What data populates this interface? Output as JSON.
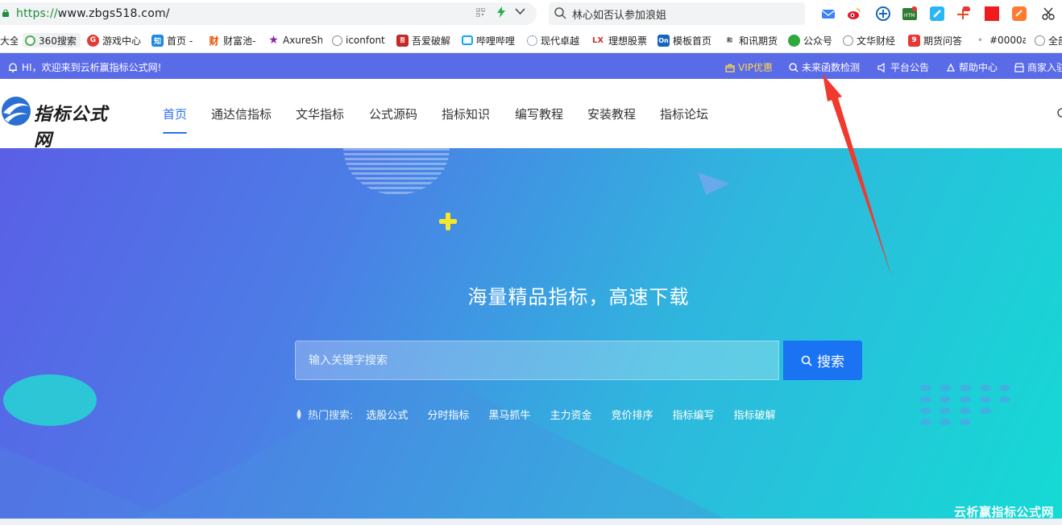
{
  "browser": {
    "url": "https://www.zbgs518.com/",
    "url_protocol": "https://",
    "url_host": "www.zbgs518.com/",
    "search_text": "林心如否认参加浪姐"
  },
  "bookmarks": [
    {
      "label": "大全",
      "color": "#555555",
      "icon": ""
    },
    {
      "label": "360搜索",
      "color": "#4caf50",
      "icon": "360-icon"
    },
    {
      "label": "游戏中心",
      "color": "#e53935",
      "icon": "game-icon"
    },
    {
      "label": "首页 -",
      "color": "#1e88e5",
      "icon": "zhi-icon",
      "glyph": "知"
    },
    {
      "label": "财富池-",
      "color": "#e65100",
      "icon": "cai-icon",
      "glyph": "财"
    },
    {
      "label": "AxureSh",
      "color": "#8e24aa",
      "icon": "star-icon"
    },
    {
      "label": "iconfont",
      "color": "#888888",
      "icon": "globe-icon"
    },
    {
      "label": "吾爱破解",
      "color": "#c62828",
      "icon": "52pj-icon"
    },
    {
      "label": "哔哩哔哩",
      "color": "#03a9f4",
      "icon": "bilibili-icon"
    },
    {
      "label": "现代卓越",
      "color": "#3949ab",
      "icon": "xd-icon"
    },
    {
      "label": "理想股票",
      "color": "#d32f2f",
      "icon": "lx-icon",
      "glyph": "LX"
    },
    {
      "label": "模板首页",
      "color": "#1565c0",
      "icon": "on-icon",
      "glyph": "On"
    },
    {
      "label": "和讯期货",
      "color": "#333333",
      "icon": "hexun-icon"
    },
    {
      "label": "公众号",
      "color": "#2eaa3a",
      "icon": "wechat-icon"
    },
    {
      "label": "文华财经",
      "color": "#888888",
      "icon": "globe-icon"
    },
    {
      "label": "期货问答",
      "color": "#e53935",
      "icon": "nine-icon",
      "glyph": "9"
    },
    {
      "label": "#0000a",
      "color": "#aaaaaa",
      "icon": "dot-icon"
    },
    {
      "label": "全部",
      "color": "#888888",
      "icon": "globe-icon"
    }
  ],
  "infobar": {
    "welcome": "HI，欢迎来到云析赢指标公式网!",
    "vip": "VIP优惠",
    "future_check": "未来函数检测",
    "announcement": "平台公告",
    "help": "帮助中心",
    "merchant": "商家入驻"
  },
  "header": {
    "logo_text": "指标公式网",
    "nav": [
      "首页",
      "通达信指标",
      "文华指标",
      "公式源码",
      "指标知识",
      "编写教程",
      "安装教程",
      "指标论坛"
    ]
  },
  "hero": {
    "title": "海量精品指标，高速下载",
    "search_placeholder": "输入关键字搜索",
    "search_button": "搜索",
    "hot_label": "热门搜索:",
    "hot_keywords": [
      "选股公式",
      "分时指标",
      "黑马抓牛",
      "主力资金",
      "竞价排序",
      "指标编写",
      "指标破解"
    ]
  },
  "watermark": "云析赢指标公式网",
  "colors": {
    "infobar_bg": "#5a6be8",
    "nav_active": "#2f6fe8",
    "search_button": "#1a73f2",
    "annotation_arrow": "#f03a2e"
  }
}
